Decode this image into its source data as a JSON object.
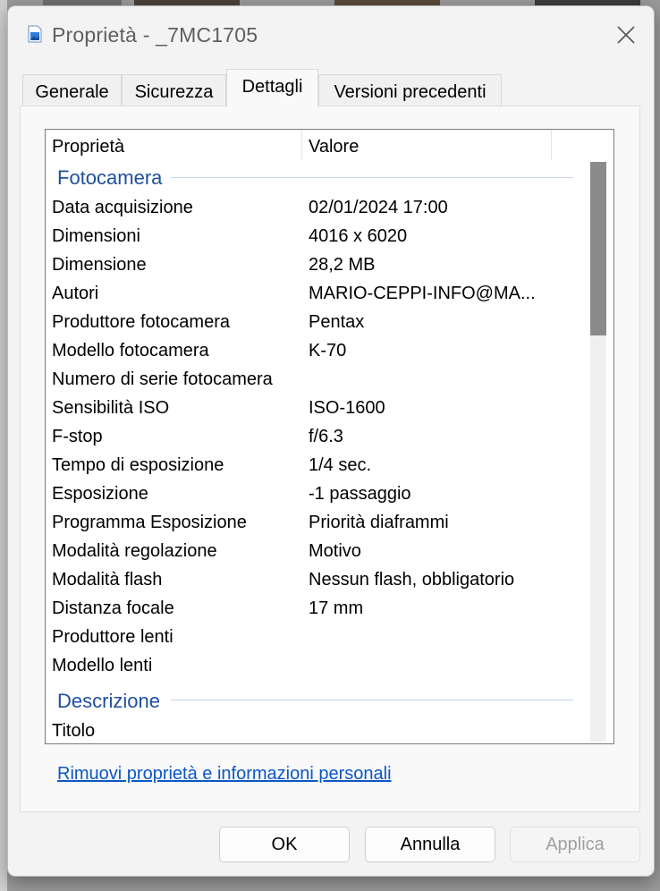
{
  "window": {
    "title": "Proprietà - _7MC1705",
    "icon": "image-file-icon"
  },
  "tabs": [
    {
      "label": "Generale",
      "active": false
    },
    {
      "label": "Sicurezza",
      "active": false
    },
    {
      "label": "Dettagli",
      "active": true
    },
    {
      "label": "Versioni precedenti",
      "active": false
    }
  ],
  "list": {
    "columns": [
      "Proprietà",
      "Valore"
    ],
    "groups": [
      {
        "title": "Fotocamera",
        "rows": [
          {
            "name": "Data acquisizione",
            "value": "02/01/2024 17:00"
          },
          {
            "name": "Dimensioni",
            "value": "4016 x 6020"
          },
          {
            "name": "Dimensione",
            "value": "28,2 MB"
          },
          {
            "name": "Autori",
            "value": "MARIO-CEPPI-INFO@MA..."
          },
          {
            "name": "Produttore fotocamera",
            "value": "Pentax"
          },
          {
            "name": "Modello fotocamera",
            "value": "K-70"
          },
          {
            "name": "Numero di serie fotocamera",
            "value": ""
          },
          {
            "name": "Sensibilità ISO",
            "value": "ISO-1600"
          },
          {
            "name": "F-stop",
            "value": "f/6.3"
          },
          {
            "name": "Tempo di esposizione",
            "value": "1/4 sec."
          },
          {
            "name": "Esposizione",
            "value": "-1 passaggio"
          },
          {
            "name": "Programma Esposizione",
            "value": "Priorità diaframmi"
          },
          {
            "name": "Modalità regolazione",
            "value": "Motivo"
          },
          {
            "name": "Modalità flash",
            "value": "Nessun flash, obbligatorio"
          },
          {
            "name": "Distanza focale",
            "value": "17 mm"
          },
          {
            "name": "Produttore lenti",
            "value": ""
          },
          {
            "name": "Modello lenti",
            "value": ""
          }
        ]
      },
      {
        "title": "Descrizione",
        "rows": [
          {
            "name": "Titolo",
            "value": ""
          }
        ]
      }
    ]
  },
  "remove_link": "Rimuovi proprietà e informazioni personali",
  "buttons": {
    "ok": "OK",
    "cancel": "Annulla",
    "apply": "Applica"
  },
  "colors": {
    "group_title": "#1f4fa0",
    "link": "#0b57c7",
    "scroll_thumb": "#8a8a8a"
  }
}
